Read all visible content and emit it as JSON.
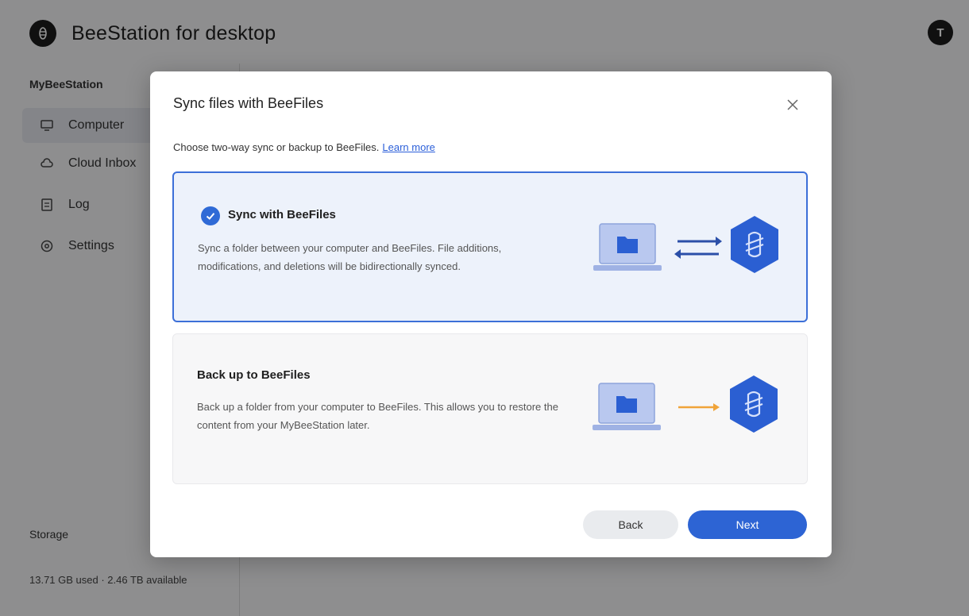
{
  "app": {
    "title": "BeeStation for desktop",
    "avatar_initial": "T"
  },
  "sidebar": {
    "heading": "MyBeeStation",
    "items": [
      {
        "label": "Computer",
        "icon": "computer-icon",
        "active": true
      },
      {
        "label": "Cloud Inbox",
        "icon": "cloud-icon",
        "active": false
      },
      {
        "label": "Log",
        "icon": "log-icon",
        "active": false
      },
      {
        "label": "Settings",
        "icon": "settings-icon",
        "active": false
      }
    ],
    "storage_label": "Storage",
    "storage_text": "13.71 GB used · 2.46 TB available"
  },
  "modal": {
    "title": "Sync files with BeeFiles",
    "description": "Choose two-way sync or backup to BeeFiles.",
    "learn_more": "Learn more",
    "options": [
      {
        "title": "Sync with BeeFiles",
        "description": "Sync a folder between your computer and BeeFiles. File additions, modifications, and deletions will be bidirectionally synced.",
        "selected": true
      },
      {
        "title": "Back up to BeeFiles",
        "description": "Back up a folder from your computer to BeeFiles. This allows you to restore the content from your MyBeeStation later.",
        "selected": false
      }
    ],
    "back_label": "Back",
    "next_label": "Next"
  },
  "colors": {
    "accent": "#2d64d4",
    "selected_bg": "#edf2fb",
    "hexagon": "#2b5fd2",
    "backup_arrow": "#f0a43a"
  }
}
